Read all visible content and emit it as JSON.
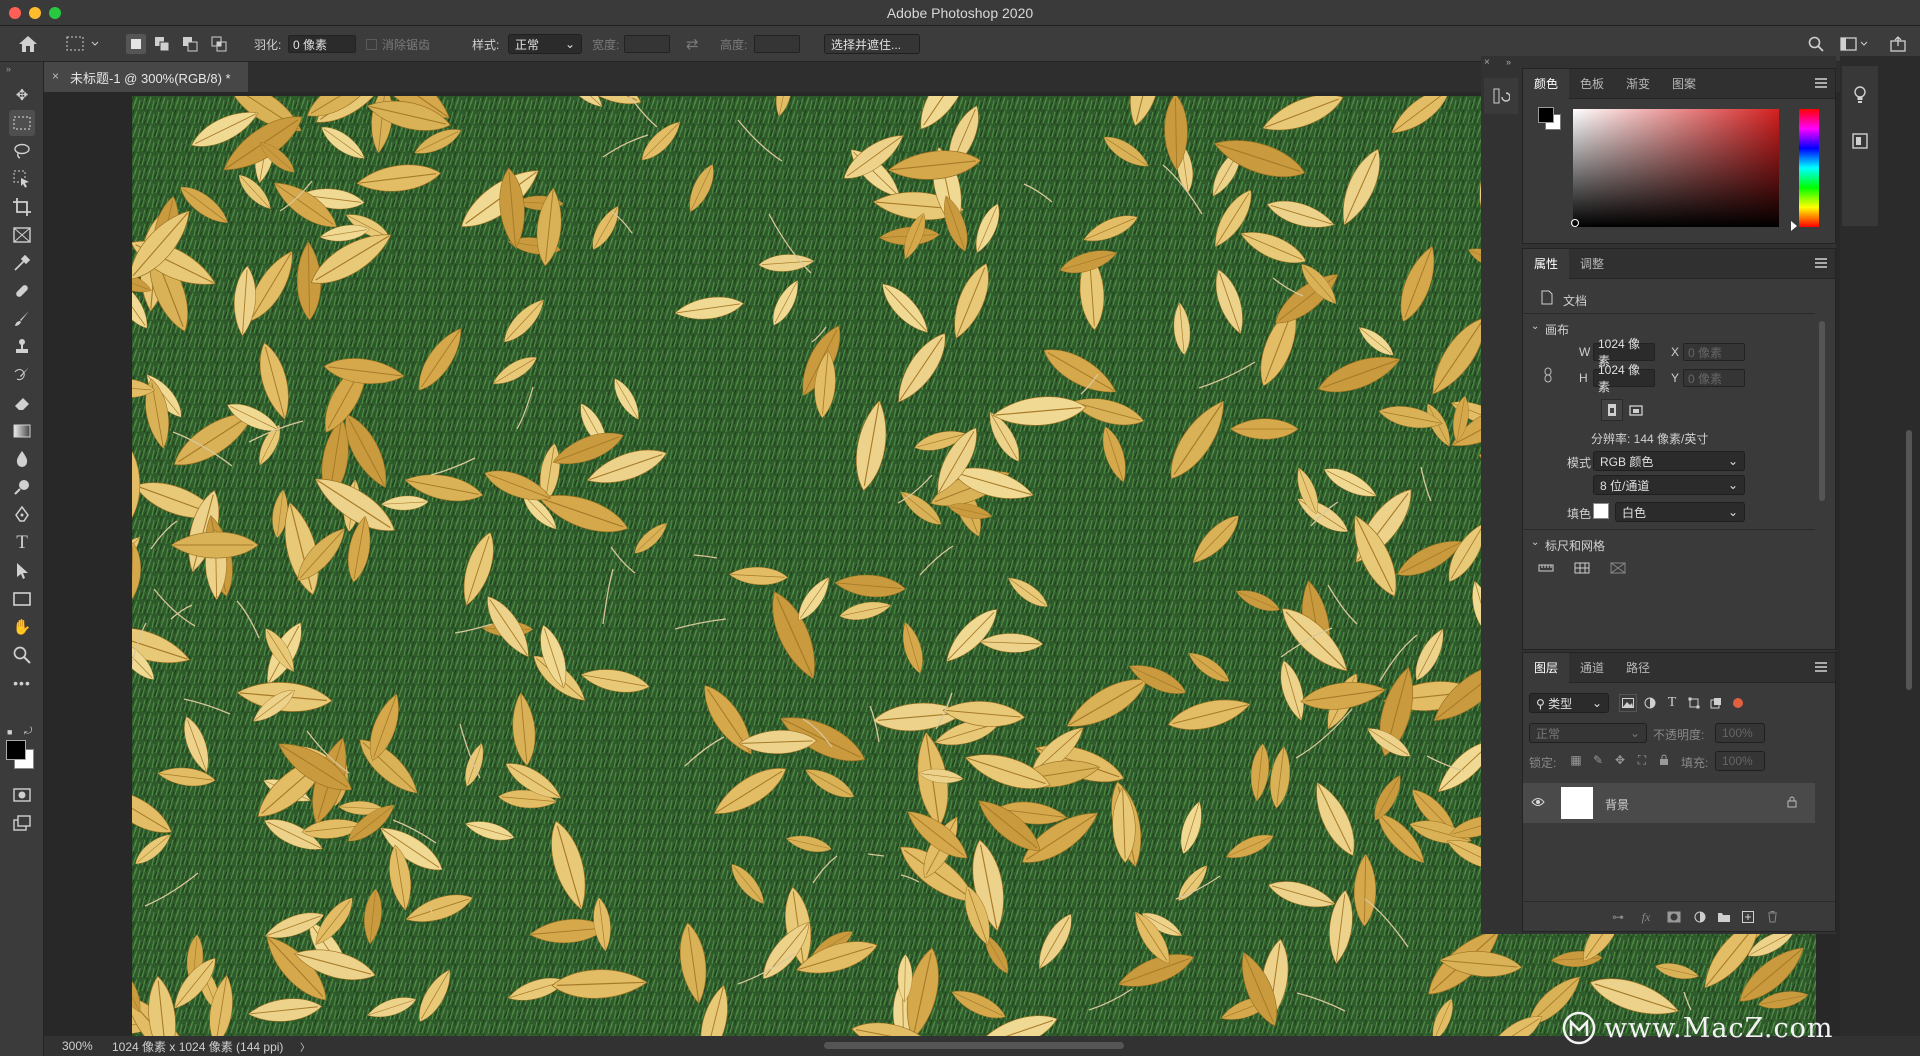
{
  "window": {
    "title": "Adobe Photoshop 2020",
    "close_color": "#ff5f57",
    "min_color": "#febc2e",
    "max_color": "#28c840"
  },
  "options": {
    "feather_label": "羽化:",
    "feather_value": "0 像素",
    "antialias_label": "消除锯齿",
    "style_label": "样式:",
    "style_value": "正常",
    "width_label": "宽度:",
    "height_label": "高度:",
    "select_mask": "选择并遮住..."
  },
  "document": {
    "tab_title": "未标题-1 @ 300%(RGB/8) *"
  },
  "status": {
    "zoom": "300%",
    "info": "1024 像素 x 1024 像素 (144 ppi)",
    "arrow": "〉"
  },
  "color_panel": {
    "tabs": [
      "颜色",
      "色板",
      "渐变",
      "图案"
    ],
    "foreground": "#000000",
    "background": "#ffffff",
    "hue": "#d42020"
  },
  "properties_panel": {
    "tabs": [
      "属性",
      "调整"
    ],
    "doc_label": "文档",
    "canvas_section": "画布",
    "w_label": "W",
    "w_value": "1024 像素",
    "h_label": "H",
    "h_value": "1024 像素",
    "x_label": "X",
    "x_value": "0 像素",
    "y_label": "Y",
    "y_value": "0 像素",
    "resolution": "分辨率: 144 像素/英寸",
    "mode_label": "模式",
    "mode_value": "RGB 颜色",
    "depth_value": "8 位/通道",
    "fill_label": "填色",
    "fill_value": "白色",
    "rulers_section": "标尺和网格"
  },
  "layers_panel": {
    "tabs": [
      "图层",
      "通道",
      "路径"
    ],
    "filter_kind": "类型",
    "blend_mode": "正常",
    "opacity_label": "不透明度:",
    "opacity_value": "100%",
    "lock_label": "锁定:",
    "fill_label": "填充:",
    "fill_value": "100%",
    "layers": [
      {
        "name": "背景"
      }
    ]
  },
  "watermark": "www.MacZ.com"
}
